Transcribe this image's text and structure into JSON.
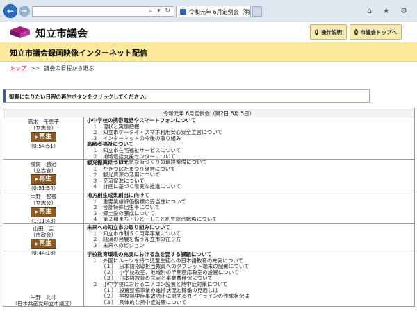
{
  "browser": {
    "tab_title": "令和元年 6月定例会（第2...",
    "tab_close": "×",
    "address_icons": "⌕ ▾ ↻",
    "window_icons": "⌂ ★ ⚙"
  },
  "site": {
    "title": "知立市議会",
    "help_label": "操作説明",
    "top_label": "市議会トップへ",
    "help_icon": "i",
    "top_icon": "›"
  },
  "banner": {
    "title": "知立市議会録画映像インターネット配信"
  },
  "breadcrumb": {
    "top": "トップ",
    "sep": ">>",
    "current": "議会の日程から選ぶ"
  },
  "instruction": "御覧になりたい日程の再生ボタンをクリックしてください。",
  "session": {
    "title": "令和元年 6月定例会（第2日 6月 5日）",
    "play_label": "再生"
  },
  "speakers": [
    {
      "name": "高木　千恵子",
      "party": "（立志会）",
      "duration": "（0:54:51）",
      "topics": [
        {
          "text": "小中学校の携帯電話やスマートフォンについて",
          "level": 0
        },
        {
          "text": "１　現状と実態把握",
          "level": 1
        },
        {
          "text": "２　知立市ケータイ・スマホ利用安心安全宣言について",
          "level": 1
        },
        {
          "text": "３　インターネットの今後の取り組み",
          "level": 1
        },
        {
          "text": "高齢者福祉について",
          "level": 0
        },
        {
          "text": "１　知立市在宅福祉サービスについて",
          "level": 1
        },
        {
          "text": "２　地域包括支援センターについて",
          "level": 1
        },
        {
          "text": "３　１００歳元気な街づくりの環境整備について",
          "level": 1
        }
      ]
    },
    {
      "name": "風間　勝治",
      "party": "（立志会）",
      "duration": "（0:51:54）",
      "topics": [
        {
          "text": "観光振興について",
          "level": 0
        },
        {
          "text": "１　かきつばたまつり経営について",
          "level": 1
        },
        {
          "text": "２　観光資源の活用について",
          "level": 1
        },
        {
          "text": "３　交流促進について",
          "level": 1
        },
        {
          "text": "４　計画に基づく着実な推進について",
          "level": 1
        }
      ]
    },
    {
      "name": "中野　智基",
      "party": "（立志会）",
      "duration": "（1:11:43）",
      "topics": [
        {
          "text": "地方創生成果創出に向けて",
          "level": 0
        },
        {
          "text": "１　重要業績評価指標の妥当性について",
          "level": 1
        },
        {
          "text": "２　合計特殊出生率について",
          "level": 1
        },
        {
          "text": "３　郷土愛の醸成について",
          "level": 1
        },
        {
          "text": "４　第２期まち・ひと・しごと創生総合戦略について",
          "level": 1
        }
      ]
    },
    {
      "name": "山田　圭",
      "party": "（市政会）",
      "duration": "（0:44:18）",
      "topics": [
        {
          "text": "未来への知立市の取り組みについて",
          "level": 0
        },
        {
          "text": "１　知立市市制５０周年事業について",
          "level": 1
        },
        {
          "text": "２　経済の発展を備う知立市の在り方",
          "level": 1
        },
        {
          "text": "３　未来へのビジョン",
          "level": 1
        }
      ]
    },
    {
      "name": "牛野　北斗",
      "party": "（日本共産党知立市議団）",
      "duration": "",
      "topics": [
        {
          "text": "学校教育環境の充実における急を要する課題について",
          "level": 0
        },
        {
          "text": "１　外国にルーツを持つ児童生徒への日本語教育の充実について",
          "level": 1
        },
        {
          "text": "（１）　日本語指導担当教員へのタブレット端末の配置について",
          "level": 2
        },
        {
          "text": "（２）　小学校教室、地域別の早期適応教室の設置について",
          "level": 2
        },
        {
          "text": "（３）　日本語教育の充実と事業費確保について",
          "level": 2
        },
        {
          "text": "２　小中学校におけるエアコン設置と熱中症対策について",
          "level": 1
        },
        {
          "text": "（１）　設置整備事業の進捗状況と稼働の見通しは",
          "level": 2
        },
        {
          "text": "（２）　学校熱中症事故防止に関するガイドラインの作成状況は",
          "level": 2
        },
        {
          "text": "（３）　具体的な熱中症対策について",
          "level": 2
        }
      ]
    }
  ]
}
